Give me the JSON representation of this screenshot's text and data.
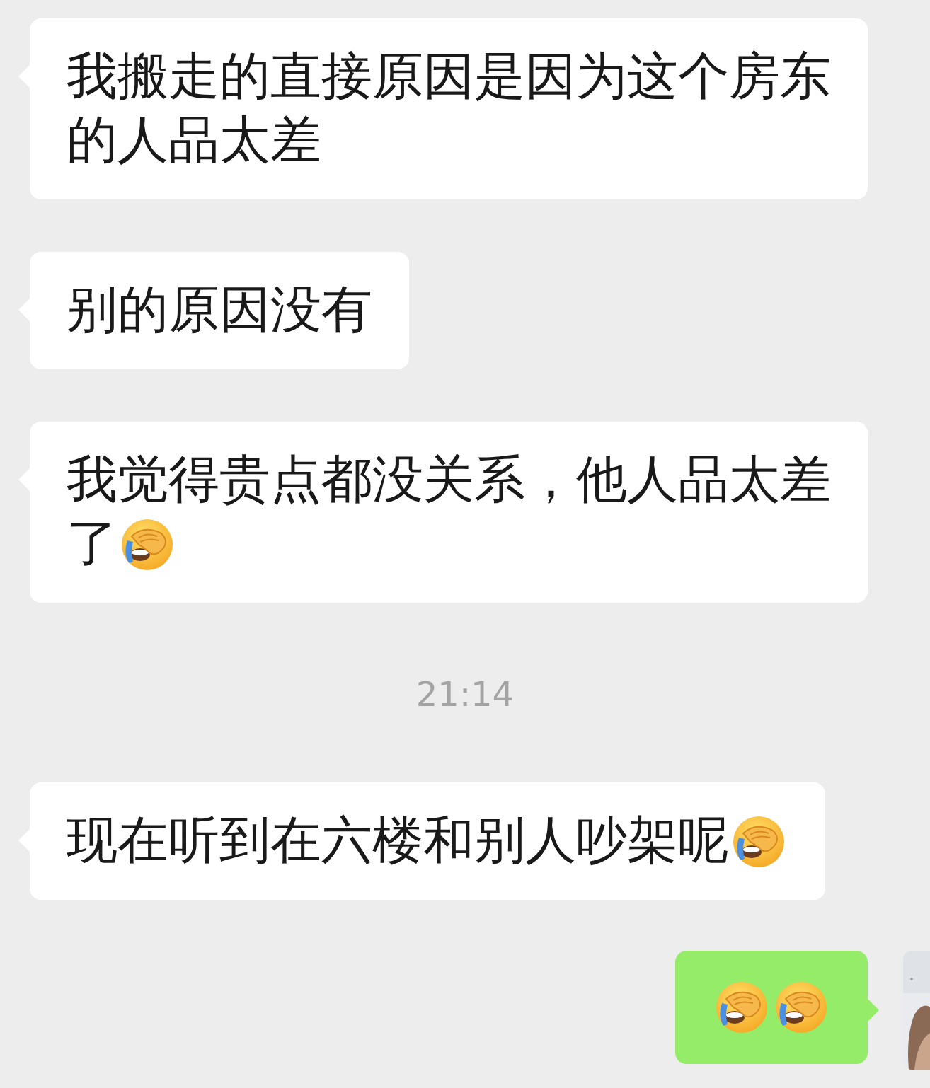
{
  "items": [
    {
      "kind": "message",
      "outgoing": false,
      "lines": [
        [
          {
            "kind": "text",
            "text": "我搬走的直接原因是因为这个房东"
          }
        ],
        [
          {
            "kind": "text",
            "text": "的人品太差"
          }
        ]
      ]
    },
    {
      "kind": "message",
      "outgoing": false,
      "lines": [
        [
          {
            "kind": "text",
            "text": "别的原因没有"
          }
        ]
      ]
    },
    {
      "kind": "message",
      "outgoing": false,
      "lines": [
        [
          {
            "kind": "text",
            "text": "我觉得贵点都没关系，他人品太差"
          }
        ],
        [
          {
            "kind": "text",
            "text": "了"
          },
          {
            "kind": "emoji"
          }
        ]
      ]
    },
    {
      "kind": "time",
      "text": "21:14"
    },
    {
      "kind": "message",
      "outgoing": false,
      "lines": [
        [
          {
            "kind": "text",
            "text": "现在听到在六楼和别人吵架呢"
          },
          {
            "kind": "emoji"
          }
        ]
      ]
    },
    {
      "kind": "message",
      "outgoing": true,
      "lines": [
        [
          {
            "kind": "emoji"
          },
          {
            "kind": "emoji"
          }
        ]
      ],
      "avatar": {
        "kind": "picture"
      }
    }
  ]
}
